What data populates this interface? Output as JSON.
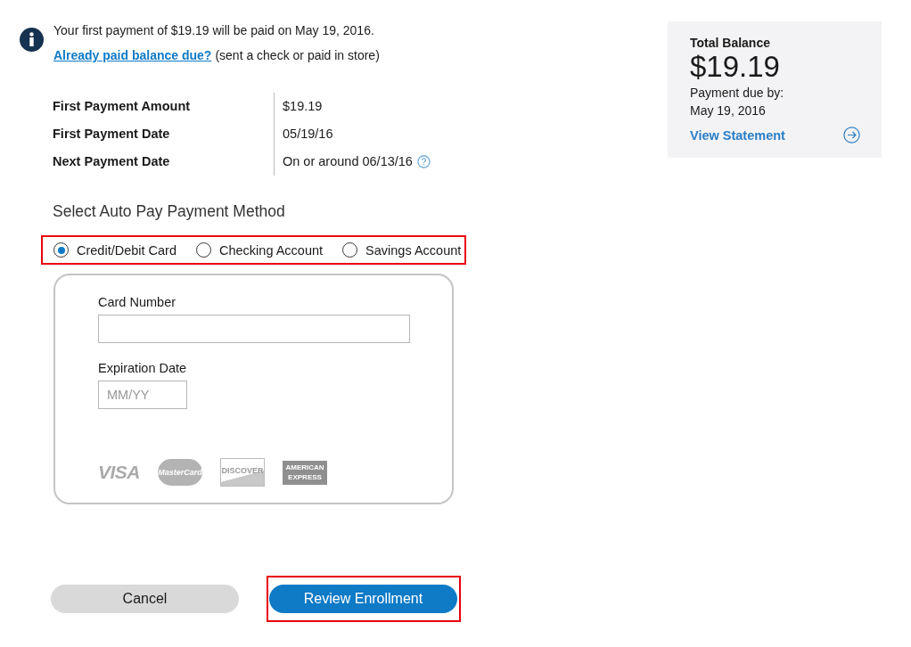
{
  "notice": {
    "message": "Your first payment of $19.19 will be paid on May 19, 2016.",
    "link": "Already paid balance due?",
    "link_note": "(sent a check or paid in store)"
  },
  "schedule": [
    {
      "label": "First Payment Amount",
      "value": "$19.19",
      "help": false
    },
    {
      "label": "First Payment Date",
      "value": "05/19/16",
      "help": false
    },
    {
      "label": "Next Payment Date",
      "value": "On or around 06/13/16",
      "help": true
    }
  ],
  "payment_method": {
    "heading": "Select Auto Pay Payment Method",
    "highlighted": true,
    "options": [
      {
        "label": "Credit/Debit Card",
        "selected": true
      },
      {
        "label": "Checking Account",
        "selected": false
      },
      {
        "label": "Savings Account",
        "selected": false
      }
    ]
  },
  "card_form": {
    "fields": [
      {
        "label": "Card Number",
        "kind": "wide"
      },
      {
        "label": "Expiration Date",
        "placeholder": "MM/YY",
        "kind": "short"
      }
    ],
    "card_logos": [
      {
        "text": "VISA",
        "kind": "plain"
      },
      {
        "text": "MasterCard",
        "kind": "circles"
      },
      {
        "text": "DISCOVER",
        "kind": "box"
      },
      {
        "text": "AMERICAN EXPRESS",
        "kind": "block"
      }
    ]
  },
  "buttons": [
    {
      "label": "Cancel",
      "kind": "secondary",
      "highlighted": false
    },
    {
      "label": "Review Enrollment",
      "kind": "primary",
      "highlighted": true
    }
  ],
  "balance": {
    "title": "Total Balance",
    "amount": "$19.19",
    "due_label": "Payment due by:",
    "due_date": "May 19, 2016",
    "link": "View Statement"
  }
}
